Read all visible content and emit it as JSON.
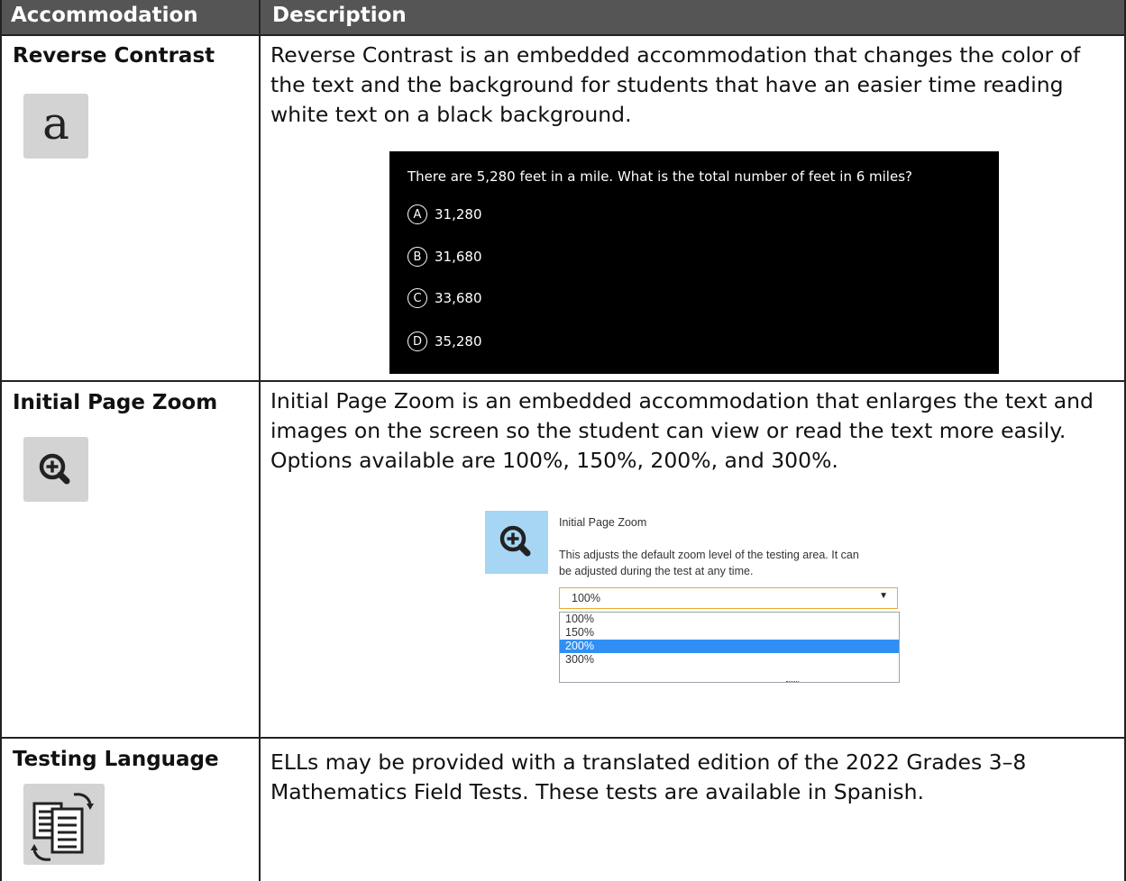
{
  "header": {
    "col1": "Accommodation",
    "col2": "Description"
  },
  "rows": [
    {
      "name": "Reverse Contrast",
      "icon": "reverse-contrast-a-icon",
      "icon_glyph": "a",
      "description": "Reverse Contrast is an embedded accommodation that changes the color of the text and the background for students that have an easier time reading white text on a black background."
    },
    {
      "name": "Initial Page Zoom",
      "icon": "zoom-in-icon",
      "description": "Initial Page Zoom is an embedded accommodation that enlarges the text and images on the screen so the student can view or read the text more easily. Options available are 100%, 150%, 200%, and 300%."
    },
    {
      "name": "Testing Language",
      "icon": "translate-document-icon",
      "description": "ELLs may be provided with a translated edition of the 2022 Grades 3–8 Mathematics Field Tests. These tests are available in Spanish."
    }
  ],
  "reverse_contrast_sample": {
    "question": "There are 5,280 feet in a mile. What is the total number of feet in 6 miles?",
    "options": [
      {
        "letter": "A",
        "value": "31,280"
      },
      {
        "letter": "B",
        "value": "31,680"
      },
      {
        "letter": "C",
        "value": "33,680"
      },
      {
        "letter": "D",
        "value": "35,280"
      }
    ]
  },
  "zoom_sample": {
    "title": "Initial Page Zoom",
    "help_line1": "This adjusts the default zoom level of the testing area. It can",
    "help_line2": "be adjusted during the test at any time.",
    "selected": "100%",
    "options": [
      "100%",
      "150%",
      "200%",
      "300%"
    ],
    "highlighted_option": "200%"
  },
  "colors": {
    "header_bg": "#555555",
    "icon_bg": "#d3d3d3",
    "zoom_icon_bg": "#a6d6f4",
    "highlight": "#2f8ff5",
    "select_border": "#f0a830"
  }
}
